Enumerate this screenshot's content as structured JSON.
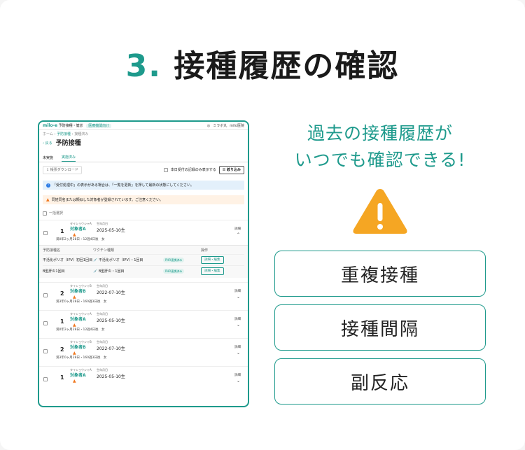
{
  "hero": {
    "number": "3.",
    "title": "接種履歴の確認"
  },
  "screenshot": {
    "app": {
      "logo": "milo-e",
      "subtitle": "予防接種・健診",
      "badge": "医療機関向け",
      "clinic": "ミラボ丸",
      "user": "milo医院"
    },
    "breadcrumb": [
      "ホーム",
      "予防接種",
      "接種済み"
    ],
    "back_label": "戻る",
    "page_title": "予防接種",
    "tabs": [
      "未実施",
      "実施済み"
    ],
    "download_label": "帳票ダウンロード",
    "filter_today_label": "本日受付の記録のみ表示する",
    "filter_button": "絞り込み",
    "info_message": "「受付処理中」の表示がある場合は、「一覧を更新」を押して最新の状態にしてください。",
    "warn_message": "同姓同名または類似した対象者が登録されています。ご注意ください。",
    "bulk_label": "一括選択",
    "detail_label": "詳細",
    "records": [
      {
        "no": "1",
        "kana": "タイショウシャA",
        "name": "対象者A",
        "birth_label": "生年月日",
        "birth": "2025-05-10生",
        "meta": "満0年2ヶ月28日・12週4日後　女"
      },
      {
        "no": "2",
        "kana": "タイショウシャB",
        "name": "対象者B",
        "birth_label": "生年月日",
        "birth": "2022-07-10生",
        "meta": "満3年0ヶ月28日・160週3日後　女"
      },
      {
        "no": "1",
        "kana": "タイショウシャA",
        "name": "対象者A",
        "birth_label": "生年月日",
        "birth": "2025-05-10生",
        "meta": "満0年2ヶ月28日・12週4日後　女"
      },
      {
        "no": "2",
        "kana": "タイショウシャB",
        "name": "対象者B",
        "birth_label": "生年月日",
        "birth": "2022-07-10生",
        "meta": "満3年0ヶ月28日・160週3日後　女"
      },
      {
        "no": "1",
        "kana": "タイショウシャA",
        "name": "対象者A",
        "birth_label": "生年月日",
        "birth": "2025-05-10生",
        "meta": ""
      }
    ],
    "vaccine_table": {
      "headers": [
        "予防接種名",
        "ワクチン種類",
        "",
        "操作"
      ],
      "rows": [
        {
          "name": "不活化ポリオ（IPV）初回1回目",
          "vaccine": "不活化ポリオ（IPV）・1回目",
          "status": "PHR連携済み",
          "action": "詳細・編集"
        },
        {
          "name": "B型肝炎1回目",
          "vaccine": "B型肝炎・1回目",
          "status": "PHR連携済み",
          "action": "詳細・編集"
        }
      ]
    }
  },
  "right": {
    "title_line1": "過去の接種履歴が",
    "title_line2": "いつでも確認できる!",
    "options": [
      "重複接種",
      "接種間隔",
      "副反応"
    ]
  },
  "colors": {
    "accent": "#1e9a8c",
    "warning": "#f5a623"
  }
}
